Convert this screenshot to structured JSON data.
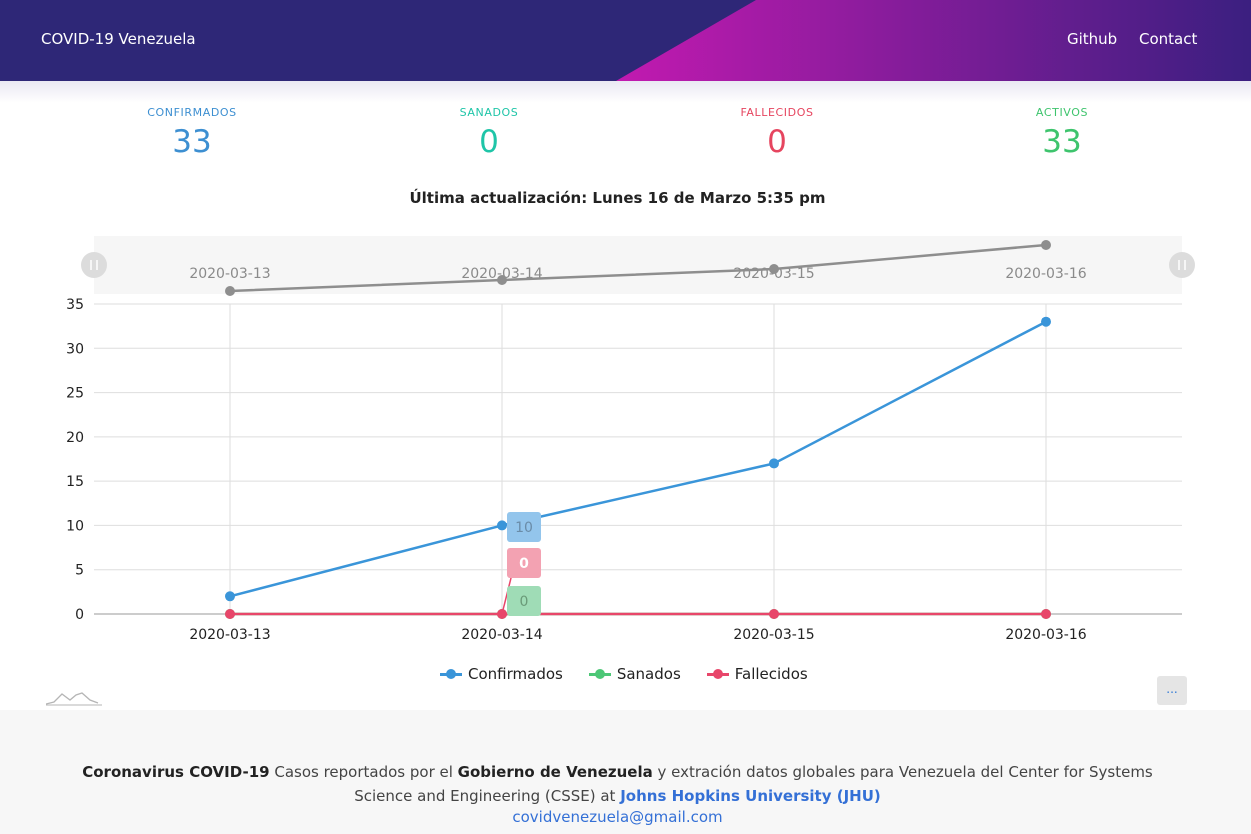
{
  "header": {
    "brand": "COVID-19 Venezuela",
    "links": [
      "Github",
      "Contact"
    ]
  },
  "stats": [
    {
      "label": "CONFIRMADOS",
      "value": "33",
      "color": "#3d8fd1"
    },
    {
      "label": "SANADOS",
      "value": "0",
      "color": "#1fc5a8"
    },
    {
      "label": "FALLECIDOS",
      "value": "0",
      "color": "#e6455f"
    },
    {
      "label": "ACTIVOS",
      "value": "33",
      "color": "#3ec46d"
    }
  ],
  "last_update": "Última actualización: Lunes 16 de Marzo 5:35 pm",
  "chart_data": {
    "type": "line",
    "categories": [
      "2020-03-13",
      "2020-03-14",
      "2020-03-15",
      "2020-03-16"
    ],
    "series": [
      {
        "name": "Confirmados",
        "values": [
          2,
          10,
          17,
          33
        ],
        "color": "#3a95d9"
      },
      {
        "name": "Sanados",
        "values": [
          0,
          0,
          0,
          0
        ],
        "color": "#4cc776"
      },
      {
        "name": "Fallecidos",
        "values": [
          0,
          0,
          0,
          0
        ],
        "color": "#e8466a"
      }
    ],
    "ylim": [
      0,
      35
    ],
    "yticks": [
      0,
      5,
      10,
      15,
      20,
      25,
      30,
      35
    ],
    "grid": true,
    "legend": "bottom-center",
    "data_zoom": {
      "categories": [
        "2020-03-13",
        "2020-03-14",
        "2020-03-15",
        "2020-03-16"
      ],
      "values": [
        2,
        10,
        17,
        33
      ],
      "color": "#8e8e8e"
    },
    "tooltip": {
      "category": "2020-03-14",
      "labels": [
        "10",
        "0",
        "0"
      ]
    }
  },
  "more_label": "...",
  "footer": {
    "t1": "Coronavirus COVID-19",
    "t2": " Casos reportados por el ",
    "t3": "Gobierno de Venezuela",
    "t4": " y extración datos globales para Venezuela del Center for Systems Science and Engineering (CSSE) at ",
    "t5": "Johns Hopkins University (JHU)",
    "email": "covidvenezuela@gmail.com"
  }
}
